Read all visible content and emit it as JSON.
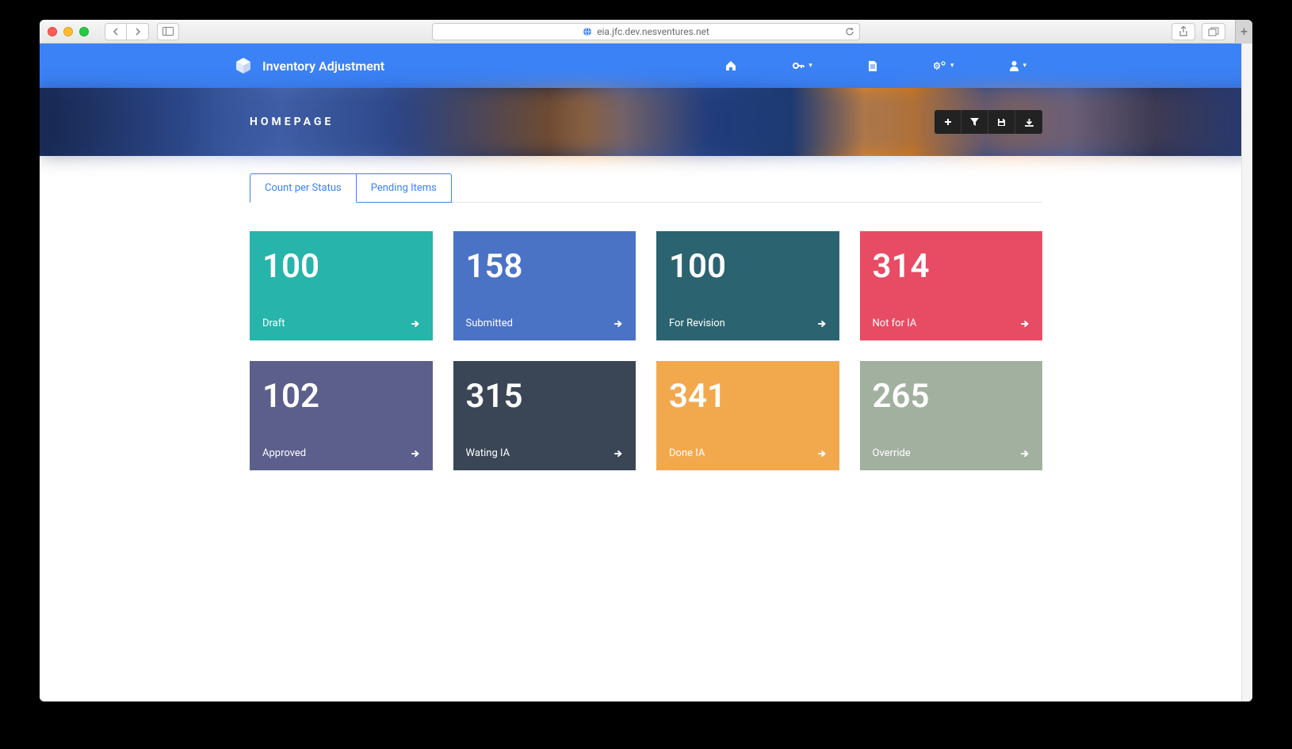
{
  "browser": {
    "url": "eia.jfc.dev.nesventures.net"
  },
  "header": {
    "app_title": "Inventory Adjustment"
  },
  "banner": {
    "title": "HOMEPAGE"
  },
  "tabs": [
    {
      "label": "Count per Status"
    },
    {
      "label": "Pending Items"
    }
  ],
  "cards": [
    {
      "count": "100",
      "label": "Draft",
      "color": "teal"
    },
    {
      "count": "158",
      "label": "Submitted",
      "color": "blue"
    },
    {
      "count": "100",
      "label": "For Revision",
      "color": "darkteal"
    },
    {
      "count": "314",
      "label": "Not for IA",
      "color": "red"
    },
    {
      "count": "102",
      "label": "Approved",
      "color": "purple"
    },
    {
      "count": "315",
      "label": "Wating IA",
      "color": "slate"
    },
    {
      "count": "341",
      "label": "Done IA",
      "color": "orange"
    },
    {
      "count": "265",
      "label": "Override",
      "color": "sage"
    }
  ]
}
